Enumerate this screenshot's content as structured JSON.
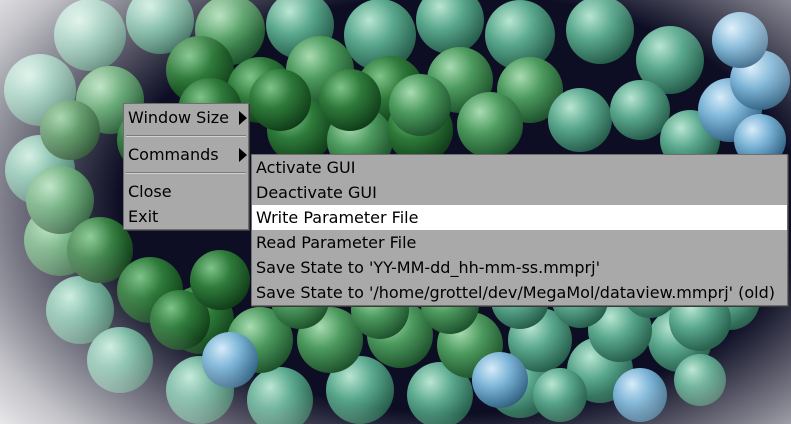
{
  "main_menu": {
    "items": [
      {
        "label": "Window Size",
        "has_submenu": true
      },
      {
        "label": "Commands",
        "has_submenu": true
      },
      {
        "label": "Close",
        "has_submenu": false
      },
      {
        "label": "Exit",
        "has_submenu": false
      }
    ]
  },
  "commands_menu": {
    "items": [
      {
        "label": "Activate GUI"
      },
      {
        "label": "Deactivate GUI"
      },
      {
        "label": "Write Parameter File"
      },
      {
        "label": "Read Parameter File"
      },
      {
        "label": "Save State to 'YY-MM-dd_hh-mm-ss.mmprj'"
      },
      {
        "label": "Save State to '/home/grottel/dev/MegaMol/dataview.mmprj' (old)"
      }
    ],
    "highlighted_index": 2
  },
  "colors": {
    "menu_bg": "#a9a9a9",
    "highlight": "#ffffff",
    "scene_bg": "#0d0d24",
    "atom_dark": "#1f5f2a",
    "atom_mid": "#3f8a4e",
    "atom_teal": "#4f9a82",
    "atom_blue": "#6fa9cf"
  }
}
